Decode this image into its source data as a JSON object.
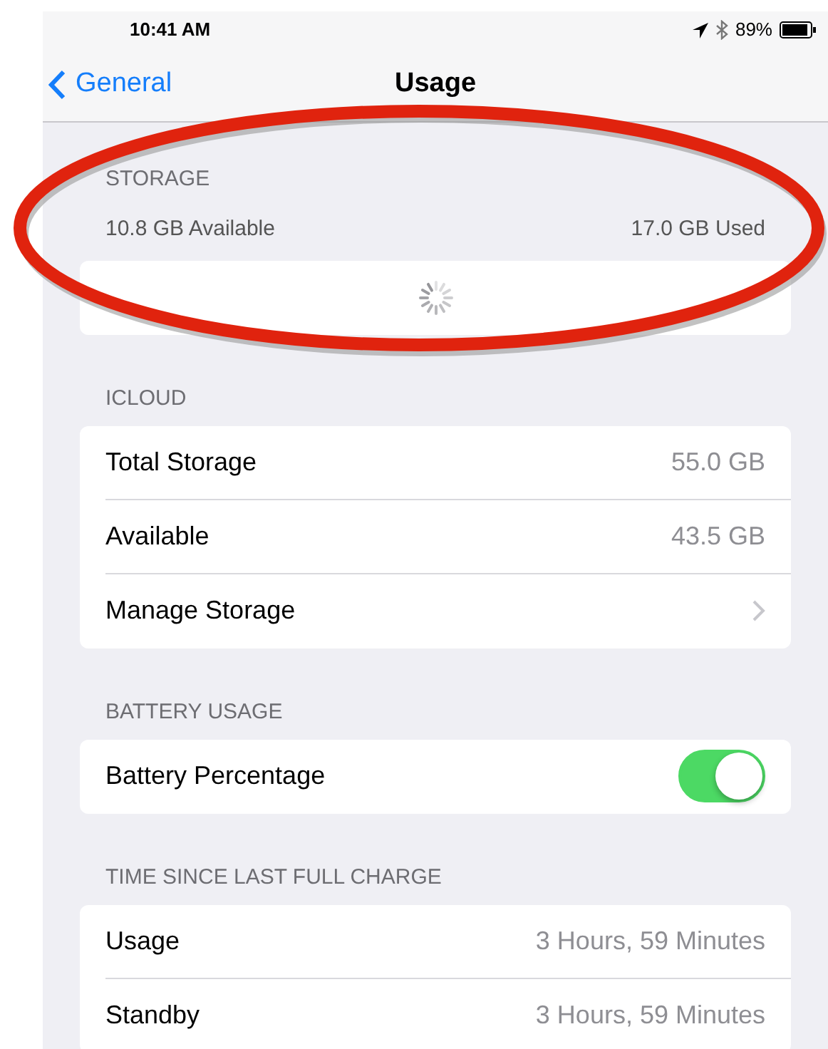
{
  "status_bar": {
    "time": "10:41 AM",
    "battery": "89%"
  },
  "nav": {
    "back": "General",
    "title": "Usage"
  },
  "storage": {
    "header": "STORAGE",
    "available": "10.8 GB Available",
    "used": "17.0 GB Used",
    "loading": true
  },
  "sections": [
    {
      "header": "ICLOUD",
      "rows": [
        {
          "kind": "value",
          "label": "Total Storage",
          "value": "55.0 GB"
        },
        {
          "kind": "value",
          "label": "Available",
          "value": "43.5 GB"
        },
        {
          "kind": "disclosure",
          "label": "Manage Storage"
        }
      ]
    },
    {
      "header": "BATTERY USAGE",
      "rows": [
        {
          "kind": "toggle",
          "label": "Battery Percentage",
          "on": true
        }
      ]
    },
    {
      "header": "TIME SINCE LAST FULL CHARGE",
      "rows": [
        {
          "kind": "value",
          "label": "Usage",
          "value": "3 Hours, 59 Minutes"
        },
        {
          "kind": "value",
          "label": "Standby",
          "value": "3 Hours, 59 Minutes"
        }
      ]
    }
  ]
}
